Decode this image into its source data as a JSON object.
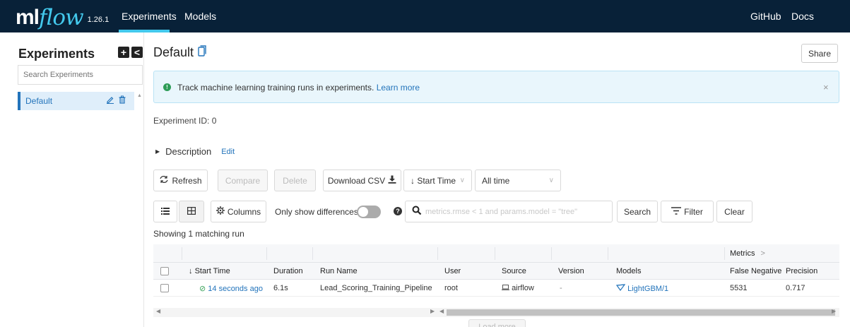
{
  "nav": {
    "logo_ml": "ml",
    "logo_flow": "flow",
    "version": "1.26.1",
    "links": [
      "Experiments",
      "Models"
    ],
    "right_links": [
      "GitHub",
      "Docs"
    ],
    "active_color": "#43c9ed",
    "bg_color": "#082138"
  },
  "sidebar": {
    "title": "Experiments",
    "add_symbol": "+",
    "collapse_symbol": "<",
    "search_placeholder": "Search Experiments",
    "items": [
      {
        "label": "Default",
        "selected": true
      }
    ]
  },
  "main": {
    "title": "Default",
    "share_label": "Share",
    "banner": {
      "text": "Track machine learning training runs in experiments.",
      "link": "Learn more",
      "close": "×"
    },
    "experiment_id_label": "Experiment ID:",
    "experiment_id": "0",
    "description_label": "Description",
    "description_edit": "Edit",
    "toolbar": {
      "refresh": "Refresh",
      "compare": "Compare",
      "delete": "Delete",
      "download_csv": "Download CSV",
      "sort_label": "Start Time",
      "time_range": "All time"
    },
    "toolbar2": {
      "columns": "Columns",
      "only_diff": "Only show differences",
      "search_placeholder": "metrics.rmse < 1 and params.model = \"tree\"",
      "search": "Search",
      "filter": "Filter",
      "clear": "Clear"
    },
    "showing": "Showing 1 matching run",
    "table": {
      "group_header": "Metrics",
      "group_chevron": ">",
      "columns": [
        "Start Time",
        "Duration",
        "Run Name",
        "User",
        "Source",
        "Version",
        "Models",
        "False Negative",
        "Precision"
      ],
      "rows": [
        {
          "start_time": "14 seconds ago",
          "duration": "6.1s",
          "run_name": "Lead_Scoring_Training_Pipeline",
          "user": "root",
          "source": "airflow",
          "version": "-",
          "models": "LightGBM/1",
          "false_negative": "5531",
          "precision": "0.717"
        }
      ]
    },
    "load_more": "Load more"
  }
}
